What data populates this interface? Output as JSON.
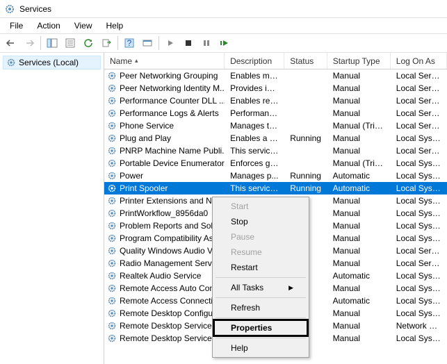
{
  "window": {
    "title": "Services"
  },
  "menubar": {
    "file": "File",
    "action": "Action",
    "view": "View",
    "help": "Help"
  },
  "sidebar": {
    "label": "Services (Local)"
  },
  "columns": {
    "name": "Name",
    "description": "Description",
    "status": "Status",
    "startup": "Startup Type",
    "logon": "Log On As"
  },
  "rows": [
    {
      "name": "Peer Networking Grouping",
      "desc": "Enables mul...",
      "status": "",
      "startup": "Manual",
      "logon": "Local Service"
    },
    {
      "name": "Peer Networking Identity M...",
      "desc": "Provides ide...",
      "status": "",
      "startup": "Manual",
      "logon": "Local Service"
    },
    {
      "name": "Performance Counter DLL ...",
      "desc": "Enables rem...",
      "status": "",
      "startup": "Manual",
      "logon": "Local Service"
    },
    {
      "name": "Performance Logs & Alerts",
      "desc": "Performanc...",
      "status": "",
      "startup": "Manual",
      "logon": "Local Service"
    },
    {
      "name": "Phone Service",
      "desc": "Manages th...",
      "status": "",
      "startup": "Manual (Trig...",
      "logon": "Local Service"
    },
    {
      "name": "Plug and Play",
      "desc": "Enables a c...",
      "status": "Running",
      "startup": "Manual",
      "logon": "Local Syste..."
    },
    {
      "name": "PNRP Machine Name Publi...",
      "desc": "This service ...",
      "status": "",
      "startup": "Manual",
      "logon": "Local Service"
    },
    {
      "name": "Portable Device Enumerator...",
      "desc": "Enforces gr...",
      "status": "",
      "startup": "Manual (Trig...",
      "logon": "Local Syste..."
    },
    {
      "name": "Power",
      "desc": "Manages p...",
      "status": "Running",
      "startup": "Automatic",
      "logon": "Local Syste..."
    },
    {
      "name": "Print Spooler",
      "desc": "This service ...",
      "status": "Running",
      "startup": "Automatic",
      "logon": "Local Syste...",
      "selected": true
    },
    {
      "name": "Printer Extensions and Notif...",
      "desc": "",
      "status": "",
      "startup": "Manual",
      "logon": "Local Syste..."
    },
    {
      "name": "PrintWorkflow_8956da0",
      "desc": "",
      "status": "",
      "startup": "Manual",
      "logon": "Local Syste..."
    },
    {
      "name": "Problem Reports and Soluti...",
      "desc": "",
      "status": "",
      "startup": "Manual",
      "logon": "Local Syste..."
    },
    {
      "name": "Program Compatibility Assi...",
      "desc": "",
      "status": "",
      "startup": "Manual",
      "logon": "Local Syste..."
    },
    {
      "name": "Quality Windows Audio Vid...",
      "desc": "",
      "status": "",
      "startup": "Manual",
      "logon": "Local Service"
    },
    {
      "name": "Radio Management Service",
      "desc": "",
      "status": "",
      "startup": "Manual",
      "logon": "Local Service"
    },
    {
      "name": "Realtek Audio Service",
      "desc": "",
      "status": "",
      "startup": "Automatic",
      "logon": "Local Syste..."
    },
    {
      "name": "Remote Access Auto Conne...",
      "desc": "",
      "status": "",
      "startup": "Manual",
      "logon": "Local Syste..."
    },
    {
      "name": "Remote Access Connection...",
      "desc": "",
      "status": "",
      "startup": "Automatic",
      "logon": "Local Syste..."
    },
    {
      "name": "Remote Desktop Configurat...",
      "desc": "",
      "status": "",
      "startup": "Manual",
      "logon": "Local Syste..."
    },
    {
      "name": "Remote Desktop Services",
      "desc": "",
      "status": "",
      "startup": "Manual",
      "logon": "Network S..."
    },
    {
      "name": "Remote Desktop Services U...",
      "desc": "",
      "status": "",
      "startup": "Manual",
      "logon": "Local Syste..."
    }
  ],
  "context_menu": {
    "start": "Start",
    "stop": "Stop",
    "pause": "Pause",
    "resume": "Resume",
    "restart": "Restart",
    "all_tasks": "All Tasks",
    "refresh": "Refresh",
    "properties": "Properties",
    "help": "Help"
  }
}
